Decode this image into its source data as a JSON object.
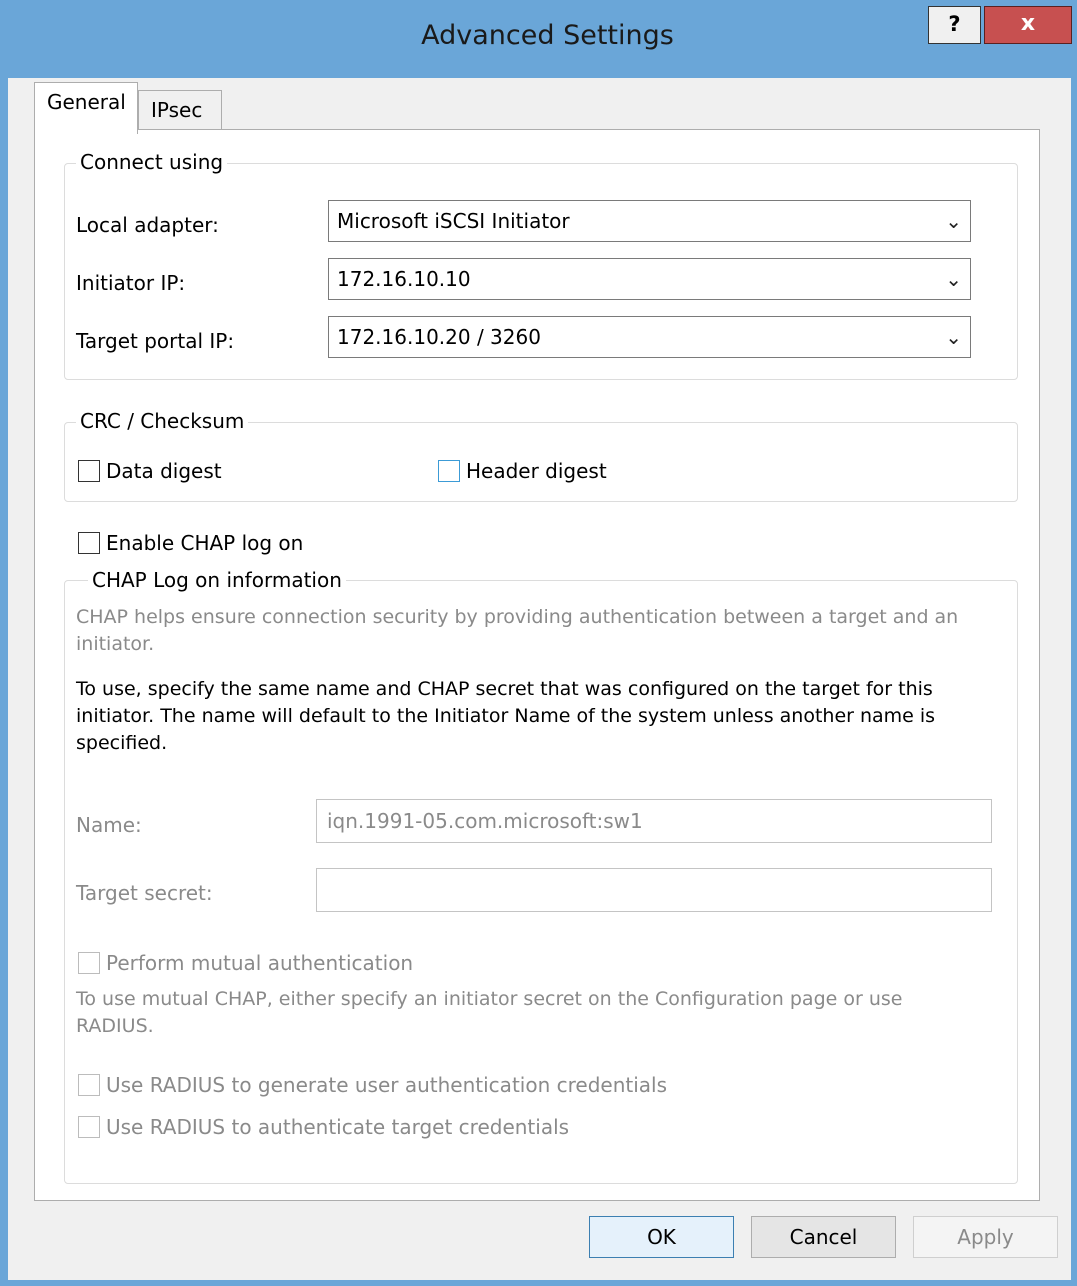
{
  "window": {
    "title": "Advanced Settings",
    "help_label": "?",
    "close_label": "x"
  },
  "tabs": [
    {
      "label": "General",
      "active": true
    },
    {
      "label": "IPsec",
      "active": false
    }
  ],
  "connect_using": {
    "title": "Connect using",
    "local_adapter_label": "Local adapter:",
    "local_adapter_value": "Microsoft iSCSI Initiator",
    "initiator_ip_label": "Initiator IP:",
    "initiator_ip_value": "172.16.10.10",
    "target_portal_label": "Target portal IP:",
    "target_portal_value": "172.16.10.20 / 3260"
  },
  "crc": {
    "title": "CRC / Checksum",
    "data_digest": "Data digest",
    "header_digest": "Header digest"
  },
  "chap": {
    "enable_label": "Enable CHAP log on",
    "group_title": "CHAP Log on information",
    "description": "CHAP helps ensure connection security by providing authentication between a target and an initiator.",
    "instructions": "To use, specify the same name and CHAP secret that was configured on the target for this initiator.  The name will default to the Initiator Name of the system unless another name is specified.",
    "name_label": "Name:",
    "name_value": "iqn.1991-05.com.microsoft:sw1",
    "secret_label": "Target secret:",
    "secret_value": "",
    "mutual_label": "Perform mutual authentication",
    "mutual_note": "To use mutual CHAP, either specify an initiator secret on the Configuration page or use RADIUS.",
    "radius_generate": "Use RADIUS to generate user authentication credentials",
    "radius_authenticate": "Use RADIUS to authenticate target credentials"
  },
  "buttons": {
    "ok": "OK",
    "cancel": "Cancel",
    "apply": "Apply"
  }
}
